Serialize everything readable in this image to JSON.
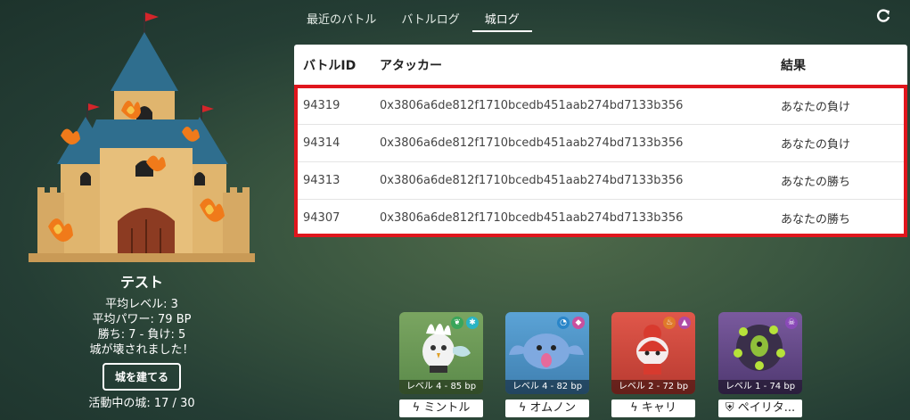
{
  "tabs": [
    {
      "label": "最近のバトル"
    },
    {
      "label": "バトルログ"
    },
    {
      "label": "城ログ"
    }
  ],
  "table": {
    "headers": [
      "バトルID",
      "アタッカー",
      "結果"
    ],
    "rows": [
      {
        "id": "94319",
        "attacker": "0x3806a6de812f1710bcedb451aab274bd7133b356",
        "result": "あなたの負け"
      },
      {
        "id": "94314",
        "attacker": "0x3806a6de812f1710bcedb451aab274bd7133b356",
        "result": "あなたの負け"
      },
      {
        "id": "94313",
        "attacker": "0x3806a6de812f1710bcedb451aab274bd7133b356",
        "result": "あなたの勝ち"
      },
      {
        "id": "94307",
        "attacker": "0x3806a6de812f1710bcedb451aab274bd7133b356",
        "result": "あなたの勝ち"
      }
    ]
  },
  "castle": {
    "name": "テスト",
    "avg_level": "平均レベル: 3",
    "avg_power": "平均パワー: 79 BP",
    "record": "勝ち: 7 - 負け: 5",
    "destroyed": "城が壊されました！",
    "build_button": "城を建てる",
    "active": "活動中の城: 17 / 30"
  },
  "cards": [
    {
      "level": "レベル 4 - 85 bp",
      "name": "ミントル",
      "icon": "lightning-icon",
      "color": "#6e9a58"
    },
    {
      "level": "レベル 4 - 82 bp",
      "name": "オムノン",
      "icon": "lightning-icon",
      "color": "#4f93c9"
    },
    {
      "level": "レベル 2 - 72 bp",
      "name": "キャリ",
      "icon": "lightning-icon",
      "color": "#c9463b"
    },
    {
      "level": "レベル 1 - 74 bp",
      "name": "ペイリタ...",
      "icon": "shield-icon",
      "color": "#6b4d8c"
    }
  ],
  "colors": {
    "highlight": "#e0161d",
    "accent": "#ffffff"
  }
}
